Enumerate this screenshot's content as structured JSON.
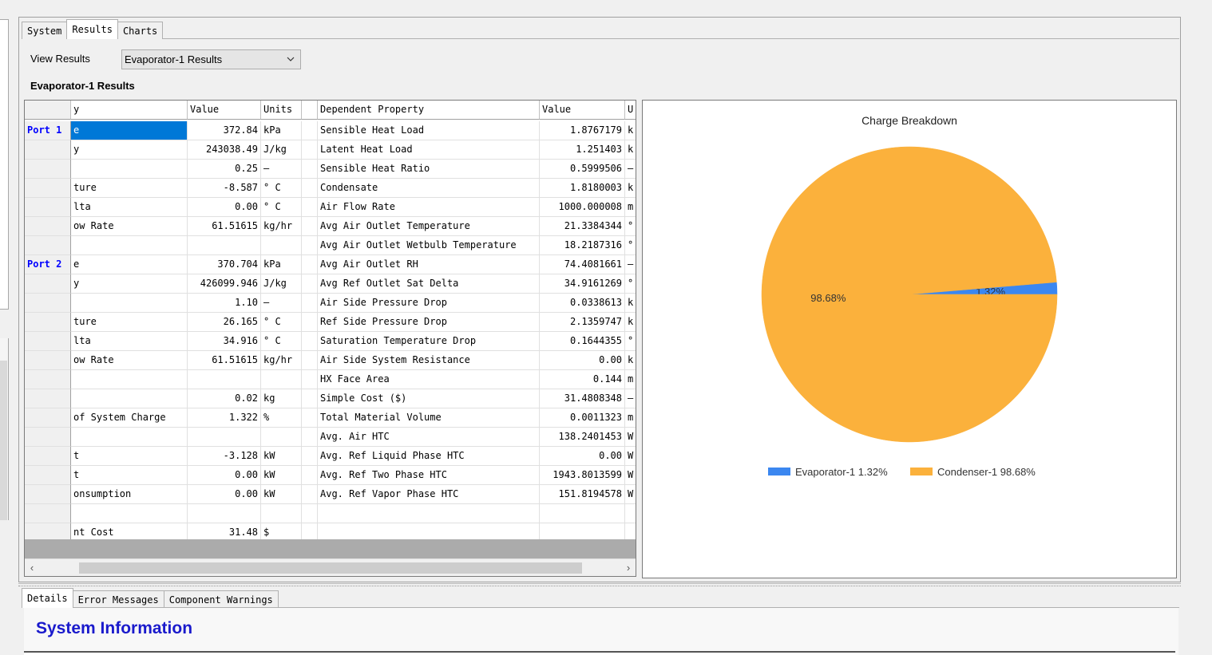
{
  "tabs": [
    "System",
    "Results",
    "Charts"
  ],
  "view_results_label": "View Results",
  "results_select_value": "Evaporator-1 Results",
  "results_heading": "Evaporator-1 Results",
  "grid": {
    "headers": [
      "",
      "y",
      "Value",
      "Units",
      "",
      "Dependent Property",
      "Value",
      "U"
    ],
    "rows": [
      [
        "Port 1",
        "e",
        "372.84",
        "kPa",
        "",
        "Sensible Heat Load",
        "1.8767179",
        "k"
      ],
      [
        "",
        "y",
        "243038.49",
        "J/kg",
        "",
        "Latent Heat Load",
        "1.251403",
        "k"
      ],
      [
        "",
        "",
        "0.25",
        "–",
        "",
        "Sensible Heat Ratio",
        "0.5999506",
        "–"
      ],
      [
        "",
        "ture",
        "-8.587",
        "° C",
        "",
        "Condensate",
        "1.8180003",
        "k"
      ],
      [
        "",
        "lta",
        "0.00",
        "° C",
        "",
        "Air Flow Rate",
        "1000.000008",
        "m"
      ],
      [
        "",
        "ow Rate",
        "61.51615",
        "kg/hr",
        "",
        "Avg Air Outlet Temperature",
        "21.3384344",
        "°"
      ],
      [
        "",
        "",
        "",
        "",
        "",
        "Avg Air Outlet Wetbulb Temperature",
        "18.2187316",
        "°"
      ],
      [
        "Port 2",
        "e",
        "370.704",
        "kPa",
        "",
        "Avg Air Outlet RH",
        "74.4081661",
        "–"
      ],
      [
        "",
        "y",
        "426099.946",
        "J/kg",
        "",
        "Avg Ref Outlet Sat Delta",
        "34.9161269",
        "°"
      ],
      [
        "",
        "",
        "1.10",
        "–",
        "",
        "Air Side Pressure Drop",
        "0.0338613",
        "k"
      ],
      [
        "",
        "ture",
        "26.165",
        "° C",
        "",
        "Ref Side Pressure Drop",
        "2.1359747",
        "k"
      ],
      [
        "",
        "lta",
        "34.916",
        "° C",
        "",
        "Saturation Temperature Drop",
        "0.1644355",
        "°"
      ],
      [
        "",
        "ow Rate",
        "61.51615",
        "kg/hr",
        "",
        "Air Side System Resistance",
        "0.00",
        "k"
      ],
      [
        "",
        "",
        "",
        "",
        "",
        "HX Face Area",
        "0.144",
        "m"
      ],
      [
        "",
        "",
        "0.02",
        "kg",
        "",
        "Simple Cost ($)",
        "31.4808348",
        "–"
      ],
      [
        "",
        " of System Charge",
        "1.322",
        "%",
        "",
        "Total Material Volume",
        "0.0011323",
        "m"
      ],
      [
        "",
        "",
        "",
        "",
        "",
        "Avg. Air HTC",
        "138.2401453",
        "W"
      ],
      [
        "",
        "t",
        "-3.128",
        "kW",
        "",
        "Avg. Ref Liquid Phase HTC",
        "0.00",
        "W"
      ],
      [
        "",
        "t",
        "0.00",
        "kW",
        "",
        "Avg. Ref Two Phase HTC",
        "1943.8013599",
        "W"
      ],
      [
        "",
        "onsumption",
        "0.00",
        "kW",
        "",
        "Avg. Ref Vapor Phase HTC",
        "151.8194578",
        "W"
      ],
      [
        "",
        "",
        "",
        "",
        "",
        "",
        "",
        ""
      ],
      [
        "",
        "nt Cost",
        "31.48",
        "$",
        "",
        "",
        "",
        ""
      ]
    ]
  },
  "chart_data": {
    "type": "pie",
    "title": "Charge Breakdown",
    "labels": [
      "Evaporator-1",
      "Condenser-1"
    ],
    "values": [
      1.32,
      98.68
    ],
    "slice_labels": [
      "1.32%",
      "98.68%"
    ],
    "legend_labels": [
      "Evaporator-1  1.32%",
      "Condenser-1  98.68%"
    ],
    "colors": [
      "#3b87f0",
      "#fbb13c"
    ],
    "legend_position": "bottom"
  },
  "bottom_tabs": [
    "Details",
    "Error Messages",
    "Component Warnings"
  ],
  "system_info_title": "System Information"
}
